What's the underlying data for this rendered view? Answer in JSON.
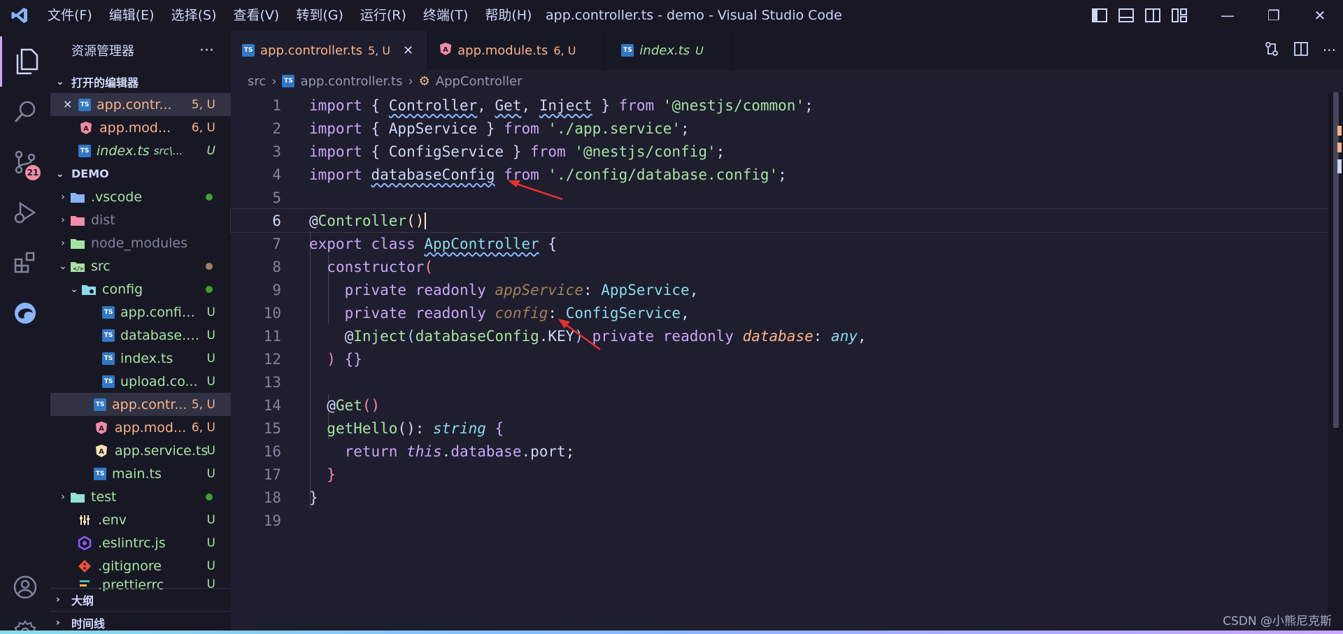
{
  "window": {
    "title": "app.controller.ts - demo - Visual Studio Code",
    "menu": [
      "文件(F)",
      "编辑(E)",
      "选择(S)",
      "查看(V)",
      "转到(G)",
      "运行(R)",
      "终端(T)",
      "帮助(H)"
    ],
    "controls": {
      "minimize": "—",
      "maximize": "❐",
      "close": "✕"
    }
  },
  "activity_bar": {
    "scm_badge": "21",
    "icons": [
      "explorer-icon",
      "search-icon",
      "source-control-icon",
      "run-debug-icon",
      "extensions-icon",
      "edge-icon",
      "account-icon",
      "settings-gear-icon"
    ]
  },
  "sidebar": {
    "title": "资源管理器",
    "more": "···",
    "open_editors": {
      "label": "打开的编辑器",
      "items": [
        {
          "close": "✕",
          "name": "app.contr...",
          "status": "5, U",
          "type": "ts"
        },
        {
          "name": "app.mod...",
          "status": "6, U",
          "type": "ng"
        },
        {
          "name": "index.ts",
          "path": "src\\...",
          "status": "U",
          "type": "ts"
        }
      ]
    },
    "project": {
      "label": "DEMO",
      "items": [
        {
          "name": ".vscode",
          "type": "folder-blue"
        },
        {
          "name": "dist",
          "type": "folder-red"
        },
        {
          "name": "node_modules",
          "type": "folder-green"
        },
        {
          "name": "src",
          "type": "folder-src"
        },
        {
          "name": "config",
          "type": "folder-config"
        },
        {
          "name": "app.config...",
          "status": "U",
          "type": "ts"
        },
        {
          "name": "database.c...",
          "status": "U",
          "type": "ts"
        },
        {
          "name": "index.ts",
          "status": "U",
          "type": "ts"
        },
        {
          "name": "upload.co...",
          "status": "U",
          "type": "ts"
        },
        {
          "name": "app.contr...",
          "status": "5, U",
          "type": "ts"
        },
        {
          "name": "app.mod...",
          "status": "6, U",
          "type": "ng"
        },
        {
          "name": "app.service.ts",
          "status": "U",
          "type": "ng-yellow"
        },
        {
          "name": "main.ts",
          "status": "U",
          "type": "ts"
        },
        {
          "name": "test",
          "type": "folder-test"
        },
        {
          "name": ".env",
          "status": "U",
          "type": "env"
        },
        {
          "name": ".eslintrc.js",
          "status": "U",
          "type": "eslint"
        },
        {
          "name": ".gitignore",
          "status": "U",
          "type": "git"
        },
        {
          "name": ".prettierrc",
          "status": "U",
          "type": "prettier"
        }
      ]
    },
    "outline": "大纲",
    "timeline": "时间线"
  },
  "tabs": [
    {
      "name": "app.controller.ts",
      "status": "5, U",
      "close": "✕"
    },
    {
      "name": "app.module.ts",
      "status": "6, U"
    },
    {
      "name": "index.ts",
      "status": "U"
    }
  ],
  "breadcrumb": {
    "folder": "src",
    "file": "app.controller.ts",
    "symbol": "AppController",
    "sep": "›"
  },
  "code": {
    "line_numbers": [
      "1",
      "2",
      "3",
      "4",
      "5",
      "6",
      "7",
      "8",
      "9",
      "10",
      "11",
      "12",
      "13",
      "14",
      "15",
      "16",
      "17",
      "18",
      "19"
    ],
    "current_line": "6"
  },
  "watermark": "CSDN @小熊尼克斯",
  "colors": {
    "keyword": "#cba6f7",
    "string": "#a6e3a1",
    "type": "#89dceb",
    "accent": "#f38ba8",
    "arrow": "#e8312f"
  }
}
